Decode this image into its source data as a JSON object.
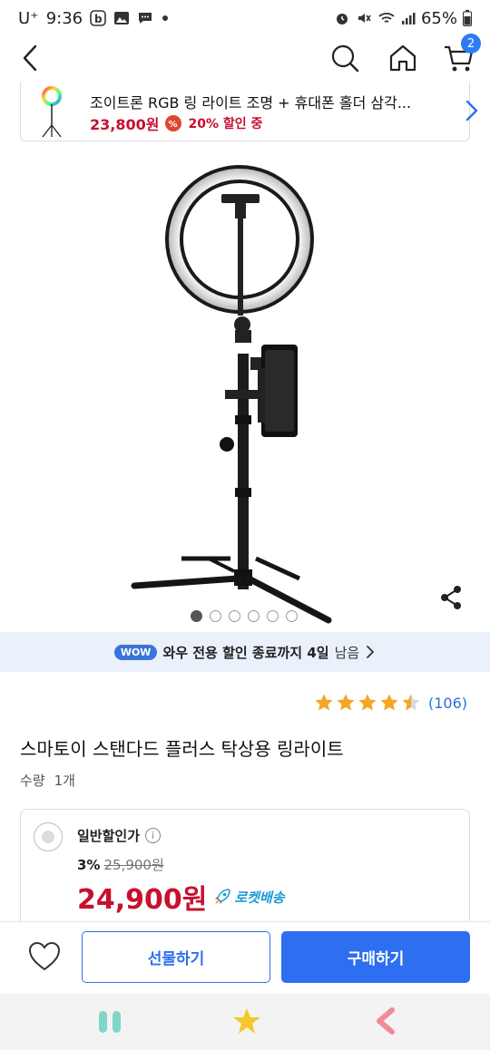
{
  "status_bar": {
    "carrier": "U⁺",
    "time": "9:36",
    "battery": "65%"
  },
  "nav": {
    "cart_count": "2"
  },
  "related": {
    "title": "조이트론 RGB 링 라이트 조명 + 휴대폰 홀더 삼각...",
    "price": "23,800원",
    "discount": "20% 할인 중"
  },
  "gallery": {
    "total": 6,
    "active_index": 0
  },
  "wow": {
    "badge": "WOW",
    "text": "와우 전용 할인 종료까지 4일",
    "remain": "남음"
  },
  "rating": {
    "stars": 4.5,
    "count": "(106)"
  },
  "product": {
    "title": "스마토이 스탠다드 플러스 탁상용 링라이트",
    "qty_label": "수량",
    "qty_value": "1개"
  },
  "option": {
    "label": "일반할인가",
    "info": "i",
    "rate": "3%",
    "original_price": "25,900원",
    "price": "24,900원",
    "delivery": "로켓배송"
  },
  "buttons": {
    "gift": "선물하기",
    "buy": "구매하기"
  },
  "colors": {
    "brand_blue": "#2d6ff0",
    "price_red": "#c8102e",
    "star": "#f5a623"
  }
}
